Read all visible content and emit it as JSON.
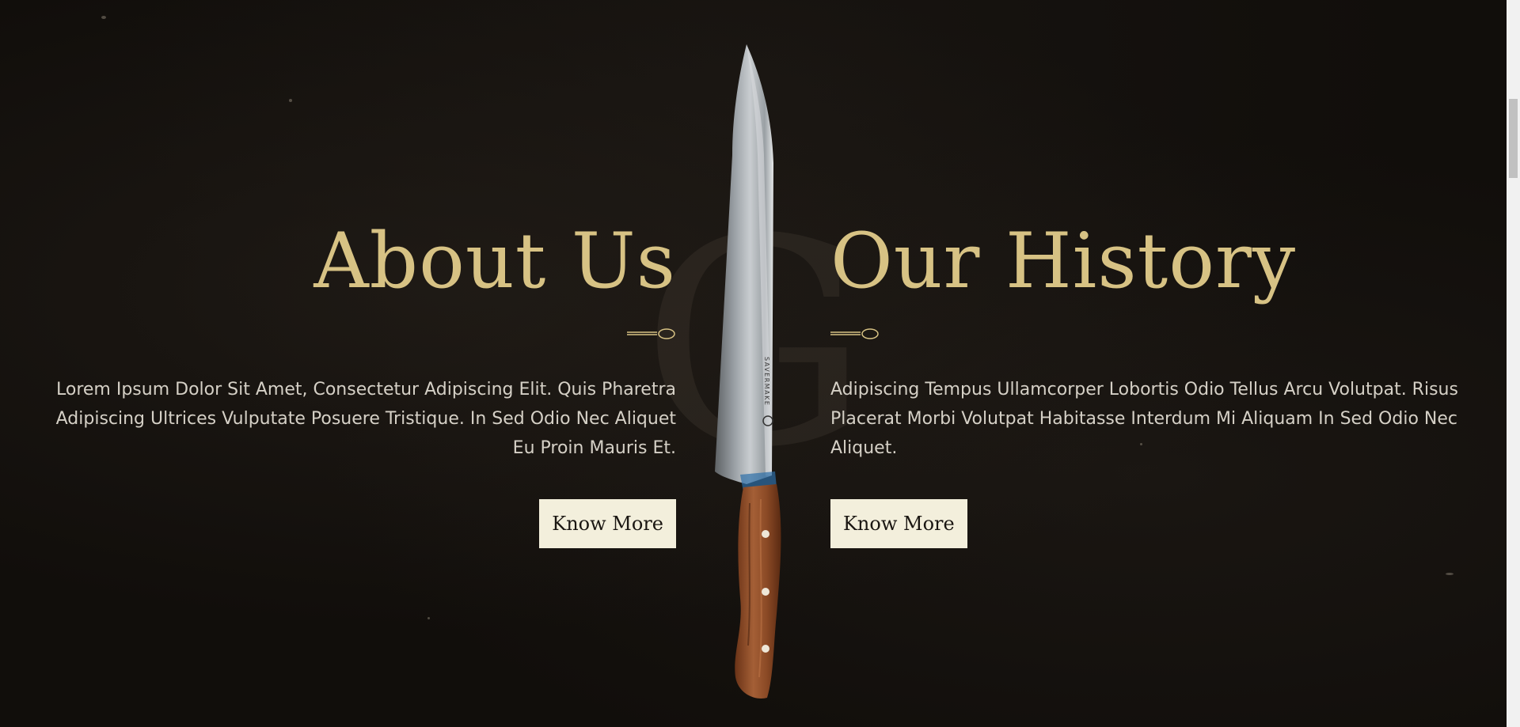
{
  "watermark": "G",
  "knife": {
    "brand_text": "SAVERMAKE"
  },
  "about": {
    "heading": "About Us",
    "text": "Lorem Ipsum Dolor Sit Amet, Consectetur Adipiscing Elit. Quis Pharetra Adipiscing Ultrices Vulputate Posuere Tristique. In Sed Odio Nec Aliquet Eu Proin Mauris Et.",
    "button_label": "Know More"
  },
  "history": {
    "heading": "Our History",
    "text": "Adipiscing Tempus Ullamcorper Lobortis Odio Tellus Arcu Volutpat. Risus Placerat Morbi Volutpat Habitasse Interdum Mi Aliquam In Sed Odio Nec Aliquet.",
    "button_label": "Know More"
  },
  "colors": {
    "heading_gold": "#d7c284",
    "button_bg": "#f3efdc",
    "background": "#110e0b"
  },
  "icons": [
    "spoon-divider-icon",
    "knife-image"
  ]
}
